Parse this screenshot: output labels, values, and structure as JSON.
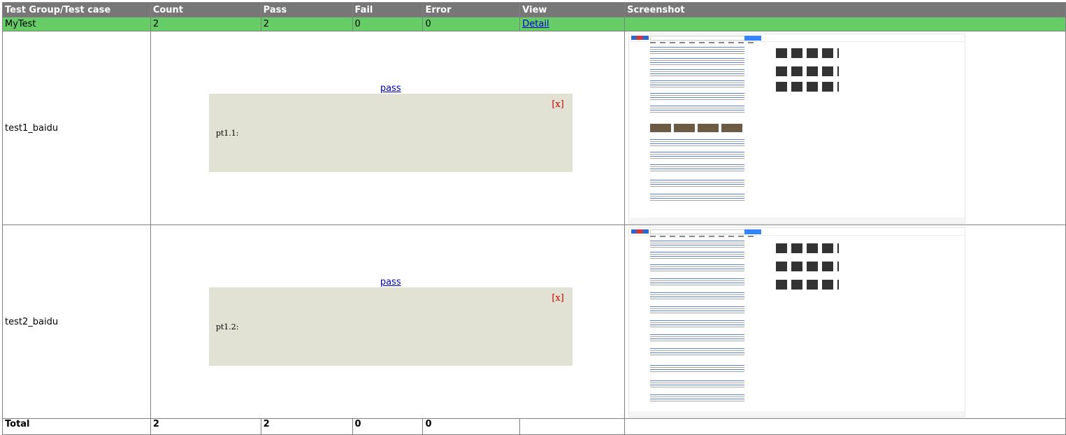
{
  "headers": {
    "name": "Test Group/Test case",
    "count": "Count",
    "pass": "Pass",
    "fail": "Fail",
    "error": "Error",
    "view": "View",
    "screenshot": "Screenshot"
  },
  "group": {
    "name": "MyTest",
    "count": "2",
    "pass": "2",
    "fail": "0",
    "error": "0",
    "view_link": "Detail"
  },
  "cases": [
    {
      "name": "test1_baidu",
      "status_link": "pass",
      "close_label": "[x]",
      "output": "pt1.1:"
    },
    {
      "name": "test2_baidu",
      "status_link": "pass",
      "close_label": "[x]",
      "output": "pt1.2:"
    }
  ],
  "total": {
    "label": "Total",
    "count": "2",
    "pass": "2",
    "fail": "0",
    "error": "0"
  },
  "colors": {
    "header_bg": "#777777",
    "group_row_bg": "#66cc66",
    "popup_bg": "#e1e2d4",
    "link": "#0000cc",
    "close": "#cc0000"
  }
}
